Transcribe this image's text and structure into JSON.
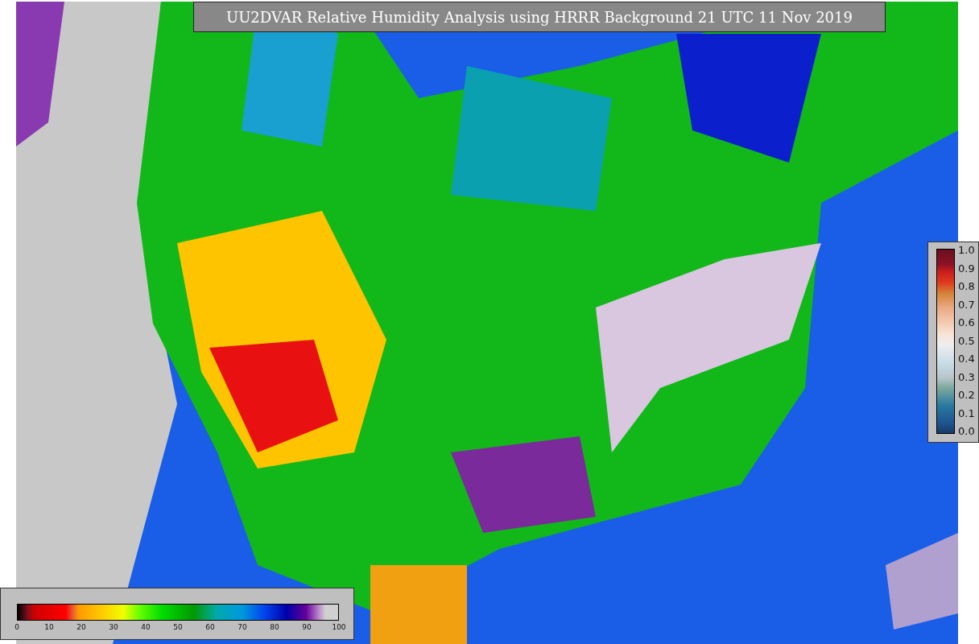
{
  "title": "UU2DVAR Relative Humidity Analysis using HRRR Background 21 UTC 11 Nov 2019",
  "side_colorbar": {
    "ticks": [
      "1.0",
      "0.9",
      "0.8",
      "0.7",
      "0.6",
      "0.5",
      "0.4",
      "0.3",
      "0.2",
      "0.1",
      "0.0"
    ]
  },
  "bottom_colorbar": {
    "ticks": [
      "0",
      "10",
      "20",
      "30",
      "40",
      "50",
      "60",
      "70",
      "80",
      "90",
      "100"
    ]
  }
}
